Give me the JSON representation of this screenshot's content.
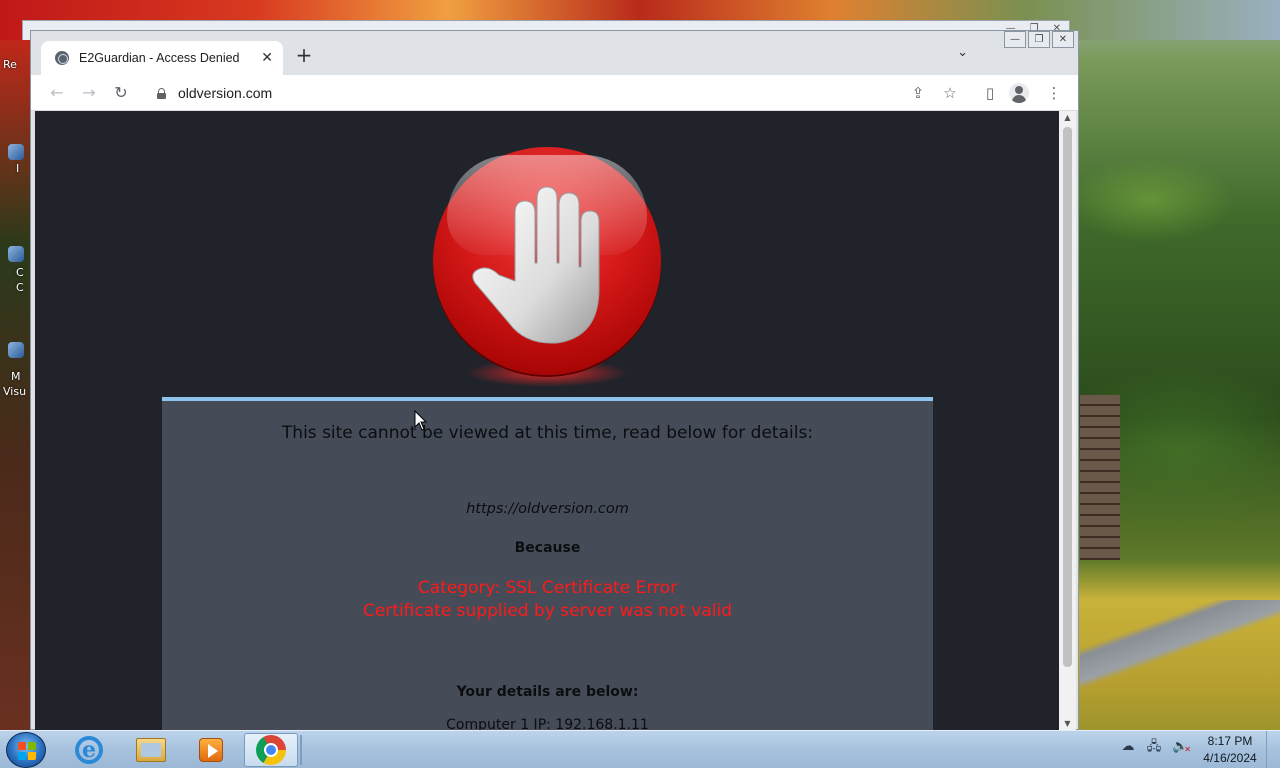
{
  "desktop": {
    "icon_labels": [
      "Re",
      "I",
      "C",
      "C",
      "M",
      "Visu"
    ]
  },
  "browser": {
    "tab": {
      "title": "E2Guardian - Access Denied",
      "close_glyph": "✕"
    },
    "new_tab_glyph": "+",
    "tab_search_glyph": "⌄",
    "window_controls": {
      "minimize": "—",
      "maximize": "❐",
      "close": "✕"
    },
    "toolbar": {
      "back_glyph": "←",
      "forward_glyph": "→",
      "reload_glyph": "↻",
      "url": "oldversion.com",
      "share_glyph": "⇪",
      "bookmark_glyph": "☆",
      "sidepanel_glyph": "▯",
      "menu_glyph": "⋮"
    }
  },
  "page": {
    "heading": "This site cannot be viewed at this time, read below for details:",
    "blocked_url": "https://oldversion.com",
    "because_label": "Because",
    "reason_category": "Category: SSL Certificate Error",
    "reason_detail": "Certificate supplied by server was not valid",
    "details_heading": "Your details are below:",
    "details_partial": "Computer     1   IP: 192.168.1.11"
  },
  "taskbar": {
    "pinned": [
      "internet-explorer",
      "file-explorer",
      "media-player",
      "google-chrome"
    ],
    "active": "google-chrome",
    "clock_time": "8:17 PM",
    "clock_date": "4/16/2024"
  },
  "colors": {
    "page_background": "#20232a",
    "panel_background": "#454b57",
    "panel_accent": "#8fc2ec",
    "error_text": "#ff1a1a"
  }
}
